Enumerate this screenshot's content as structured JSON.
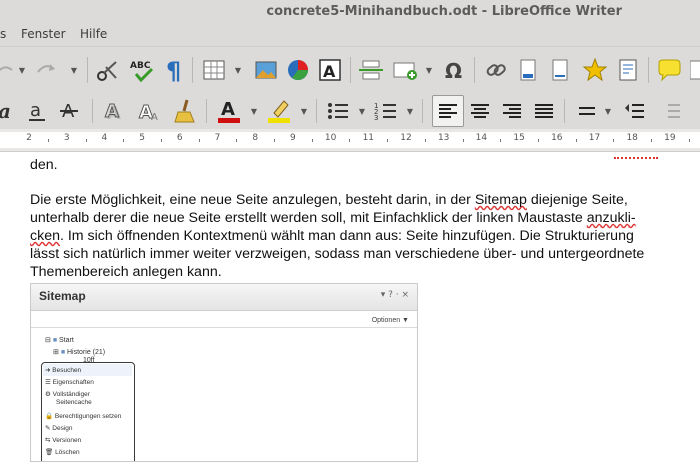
{
  "window": {
    "title": "concrete5-Minihandbuch.odt - LibreOffice Writer"
  },
  "menu": {
    "items": [
      "s",
      "Fenster",
      "Hilfe"
    ]
  },
  "ruler": {
    "numbers": [
      "2",
      "3",
      "4",
      "5",
      "6",
      "7",
      "8",
      "9",
      "10",
      "11",
      "12",
      "13",
      "14",
      "15",
      "16",
      "17",
      "18",
      "19"
    ]
  },
  "document": {
    "line0": "den.",
    "p1": {
      "l1a": "Die erste Möglichkeit, eine neue Seite anzulegen, besteht darin, in der ",
      "l1b": "Sitemap",
      "l1c": " diejenige Seite,",
      "l2a": "unterhalb derer die neue Seite erstellt werden soll, mit Einfachklick der linken Maustaste ",
      "l2b": "anzukli-",
      "l3a": "cken",
      "l3b": ". Im sich öffnenden Kontextmenü wählt man dann aus: Seite hinzufügen. Die Strukturierung",
      "l4": "lässt sich natürlich immer weiter verzweigen, sodass man verschiedene über- und untergeordnete",
      "l5": "Themenbereich anlegen kann."
    },
    "image": {
      "header": "Sitemap",
      "controls": "▾ ? · ×",
      "options": "Optionen ▼",
      "tree": [
        "Start",
        "Historie (21)",
        "10ff"
      ],
      "menu": [
        "Besuchen",
        "Eigenschaften",
        "Vollständiger",
        "Seitencache",
        "Berechtigungen setzen",
        "Design",
        "Versionen",
        "Löschen"
      ]
    }
  },
  "colors": {
    "accent": "#2a6ebb",
    "font_color_bar": "#d01010",
    "highlight_bar": "#f0e000"
  }
}
